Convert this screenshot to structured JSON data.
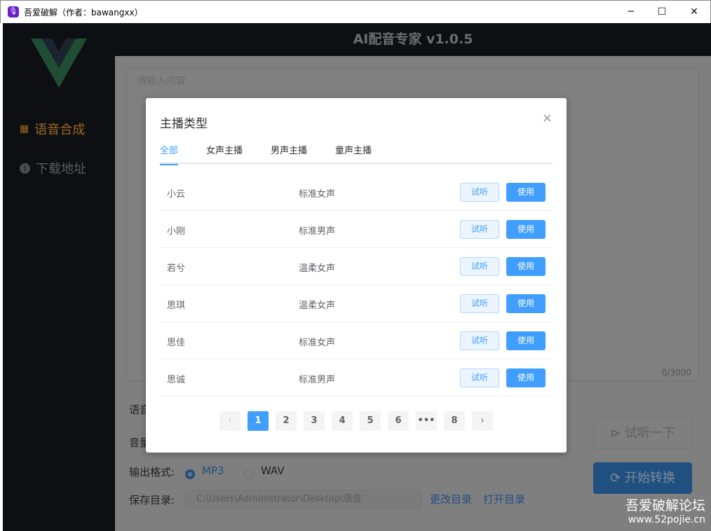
{
  "window": {
    "title": "吾爱破解（作者：bawangxx）",
    "icon": "microphone-icon",
    "minimize": "─",
    "maximize": "☐",
    "close": "✕"
  },
  "app": {
    "header_title": "AI配音专家 v1.0.5"
  },
  "sidebar": {
    "items": [
      {
        "label": "语音合成",
        "icon": "grid-icon",
        "active": true,
        "color": "#9a6a1e"
      },
      {
        "label": "下载地址",
        "icon": "info-icon",
        "active": false,
        "color": "#5a5c60"
      }
    ]
  },
  "editor": {
    "placeholder": "请输入内容",
    "count": "0/3000"
  },
  "form": {
    "voice_label": "语音",
    "volume_label": "音量",
    "format_label": "输出格式:",
    "formats": [
      "MP3",
      "WAV"
    ],
    "selected_format": "MP3",
    "dir_label": "保存目录:",
    "dir_value": "C:\\Users\\Administrator\\Desktop\\语音",
    "change_dir": "更改目录",
    "open_dir": "打开目录",
    "try_button": "试听一下",
    "start_button": "开始转换"
  },
  "watermark": {
    "line1": "吾爱破解论坛",
    "line2": "www.52pojie.cn"
  },
  "dialog": {
    "title": "主播类型",
    "close": "×",
    "tabs": [
      "全部",
      "女声主播",
      "男声主播",
      "童声主播"
    ],
    "active_tab": "全部",
    "rows": [
      {
        "name": "小云",
        "type": "标准女声"
      },
      {
        "name": "小刚",
        "type": "标准男声"
      },
      {
        "name": "若兮",
        "type": "温柔女声"
      },
      {
        "name": "思琪",
        "type": "温柔女声"
      },
      {
        "name": "思佳",
        "type": "标准女声"
      },
      {
        "name": "思诚",
        "type": "标准男声"
      }
    ],
    "listen_label": "试听",
    "use_label": "使用",
    "pagination": {
      "prev": "‹",
      "pages": [
        "1",
        "2",
        "3",
        "4",
        "5",
        "6",
        "•••",
        "8"
      ],
      "current": "1",
      "next": "›"
    },
    "accent": "#409eff"
  }
}
